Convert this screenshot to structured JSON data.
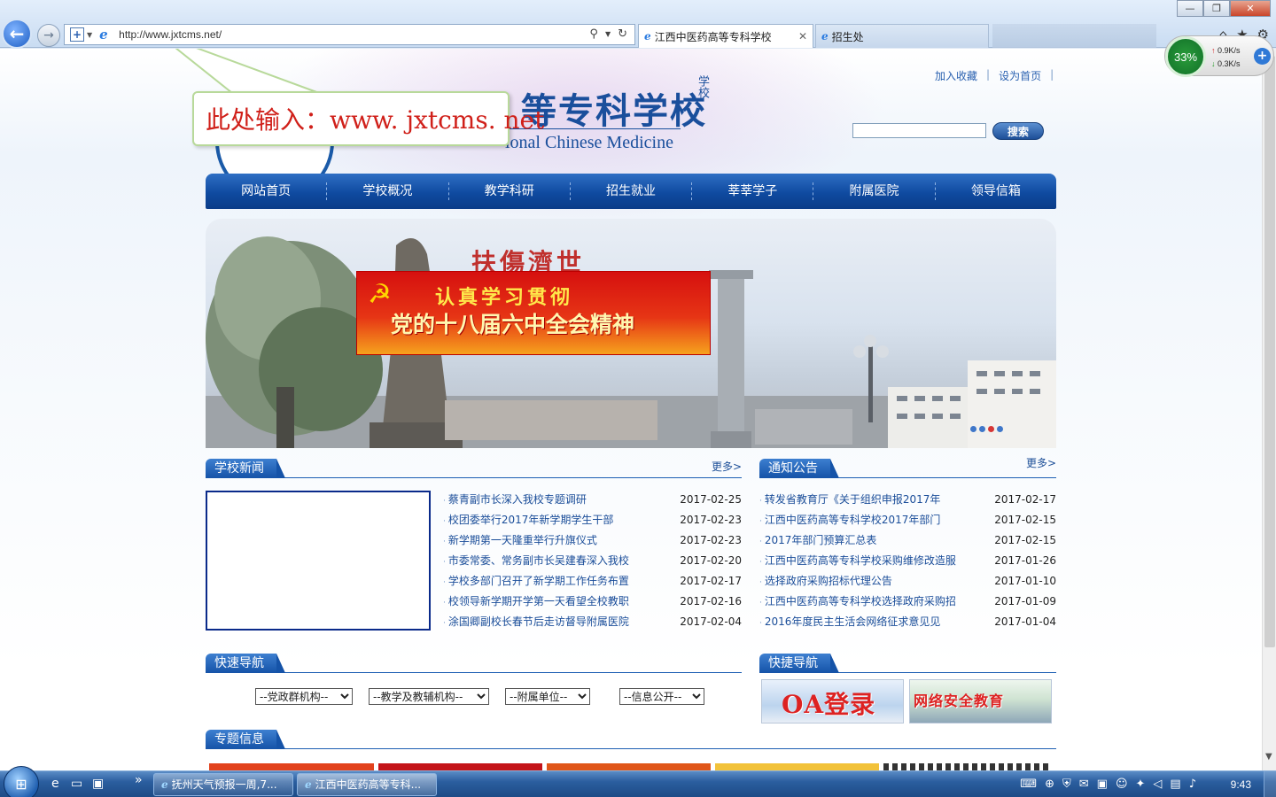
{
  "browser": {
    "url": "http://www.jxtcms.net/",
    "tabs": [
      {
        "title": "江西中医药高等专科学校",
        "close": "✕"
      },
      {
        "title": "招生处"
      }
    ],
    "window_controls": {
      "minimize": "—",
      "maximize": "❐",
      "close": "✕"
    },
    "toolbar_icons": [
      "home-icon",
      "star-icon",
      "gear-icon"
    ]
  },
  "speed_widget": {
    "percent": "33%",
    "up": "0.9K/s",
    "down": "0.3K/s"
  },
  "header": {
    "school_name_visible": "等专科学校",
    "school_side_text": "学校",
    "school_english_visible": "ional Chinese Medicine",
    "top_links": [
      "加入收藏",
      "设为首页"
    ],
    "search_button": "搜索"
  },
  "callout": {
    "text": "此处输入：www. jxtcms. net"
  },
  "main_nav": [
    "网站首页",
    "学校概况",
    "教学科研",
    "招生就业",
    "莘莘学子",
    "附属医院",
    "领导信箱"
  ],
  "banner": {
    "calligraphy": "扶傷濟世",
    "line1": "认真学习贯彻",
    "line2": "党的十八届六中全会精神"
  },
  "school_news": {
    "title": "学校新闻",
    "more": "更多>",
    "items": [
      {
        "text": "蔡青副市长深入我校专题调研",
        "date": "2017-02-25"
      },
      {
        "text": "校团委举行2017年新学期学生干部",
        "date": "2017-02-23"
      },
      {
        "text": "新学期第一天隆重举行升旗仪式",
        "date": "2017-02-23"
      },
      {
        "text": "市委常委、常务副市长吴建春深入我校",
        "date": "2017-02-20"
      },
      {
        "text": "学校多部门召开了新学期工作任务布置",
        "date": "2017-02-17"
      },
      {
        "text": "校领导新学期开学第一天看望全校教职",
        "date": "2017-02-16"
      },
      {
        "text": "涂国卿副校长春节后走访督导附属医院",
        "date": "2017-02-04"
      }
    ]
  },
  "notices": {
    "title": "通知公告",
    "more": "更多>",
    "items": [
      {
        "text": "转发省教育厅《关于组织申报2017年",
        "date": "2017-02-17"
      },
      {
        "text": "江西中医药高等专科学校2017年部门",
        "date": "2017-02-15"
      },
      {
        "text": "2017年部门预算汇总表",
        "date": "2017-02-15"
      },
      {
        "text": "江西中医药高等专科学校采购维修改造服",
        "date": "2017-01-26"
      },
      {
        "text": "选择政府采购招标代理公告",
        "date": "2017-01-10"
      },
      {
        "text": "江西中医药高等专科学校选择政府采购招",
        "date": "2017-01-09"
      },
      {
        "text": "2016年度民主生活会网络征求意见见",
        "date": "2017-01-04"
      }
    ]
  },
  "quick_nav": {
    "title": "快速导航",
    "selects": [
      "--党政群机构--",
      "--教学及教辅机构--",
      "--附属单位--",
      "--信息公开--"
    ]
  },
  "shortcut_nav": {
    "title": "快捷导航",
    "oa": "OA登录",
    "security": "网络安全教育"
  },
  "special_info": {
    "title": "专题信息"
  },
  "taskbar": {
    "tasks": [
      "抚州天气预报一周,7...",
      "江西中医药高等专科..."
    ],
    "overflow": "»",
    "clock": "9:43"
  },
  "colors": {
    "nav_blue": "#0f4aa0",
    "link_blue": "#1a4d99",
    "banner_red": "#d6100f"
  }
}
